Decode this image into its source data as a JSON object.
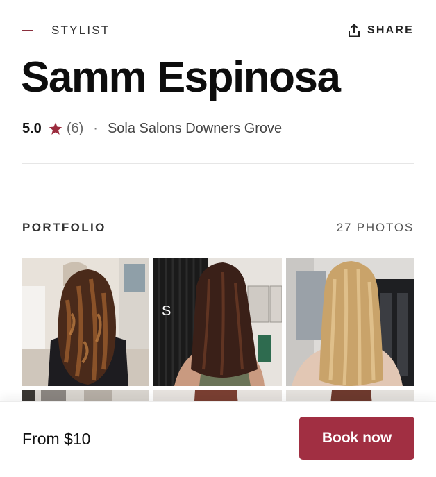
{
  "header": {
    "eyebrow": "STYLIST",
    "share_label": "SHARE"
  },
  "stylist": {
    "name": "Samm Espinosa",
    "rating": "5.0",
    "review_count": "(6)",
    "separator": "·",
    "salon": "Sola Salons Downers Grove"
  },
  "portfolio": {
    "label": "PORTFOLIO",
    "photo_count": "27 PHOTOS",
    "photos": [
      {
        "icon": "curly-brunette-balayage-photo"
      },
      {
        "icon": "long-brown-straight-hair-photo"
      },
      {
        "icon": "long-blonde-straight-hair-photo"
      },
      {
        "icon": "portfolio-photo"
      },
      {
        "icon": "portfolio-photo"
      },
      {
        "icon": "portfolio-photo"
      }
    ]
  },
  "footer": {
    "price": "From $10",
    "book_label": "Book now"
  },
  "colors": {
    "accent": "#a12f42",
    "star": "#9b2b3d"
  }
}
